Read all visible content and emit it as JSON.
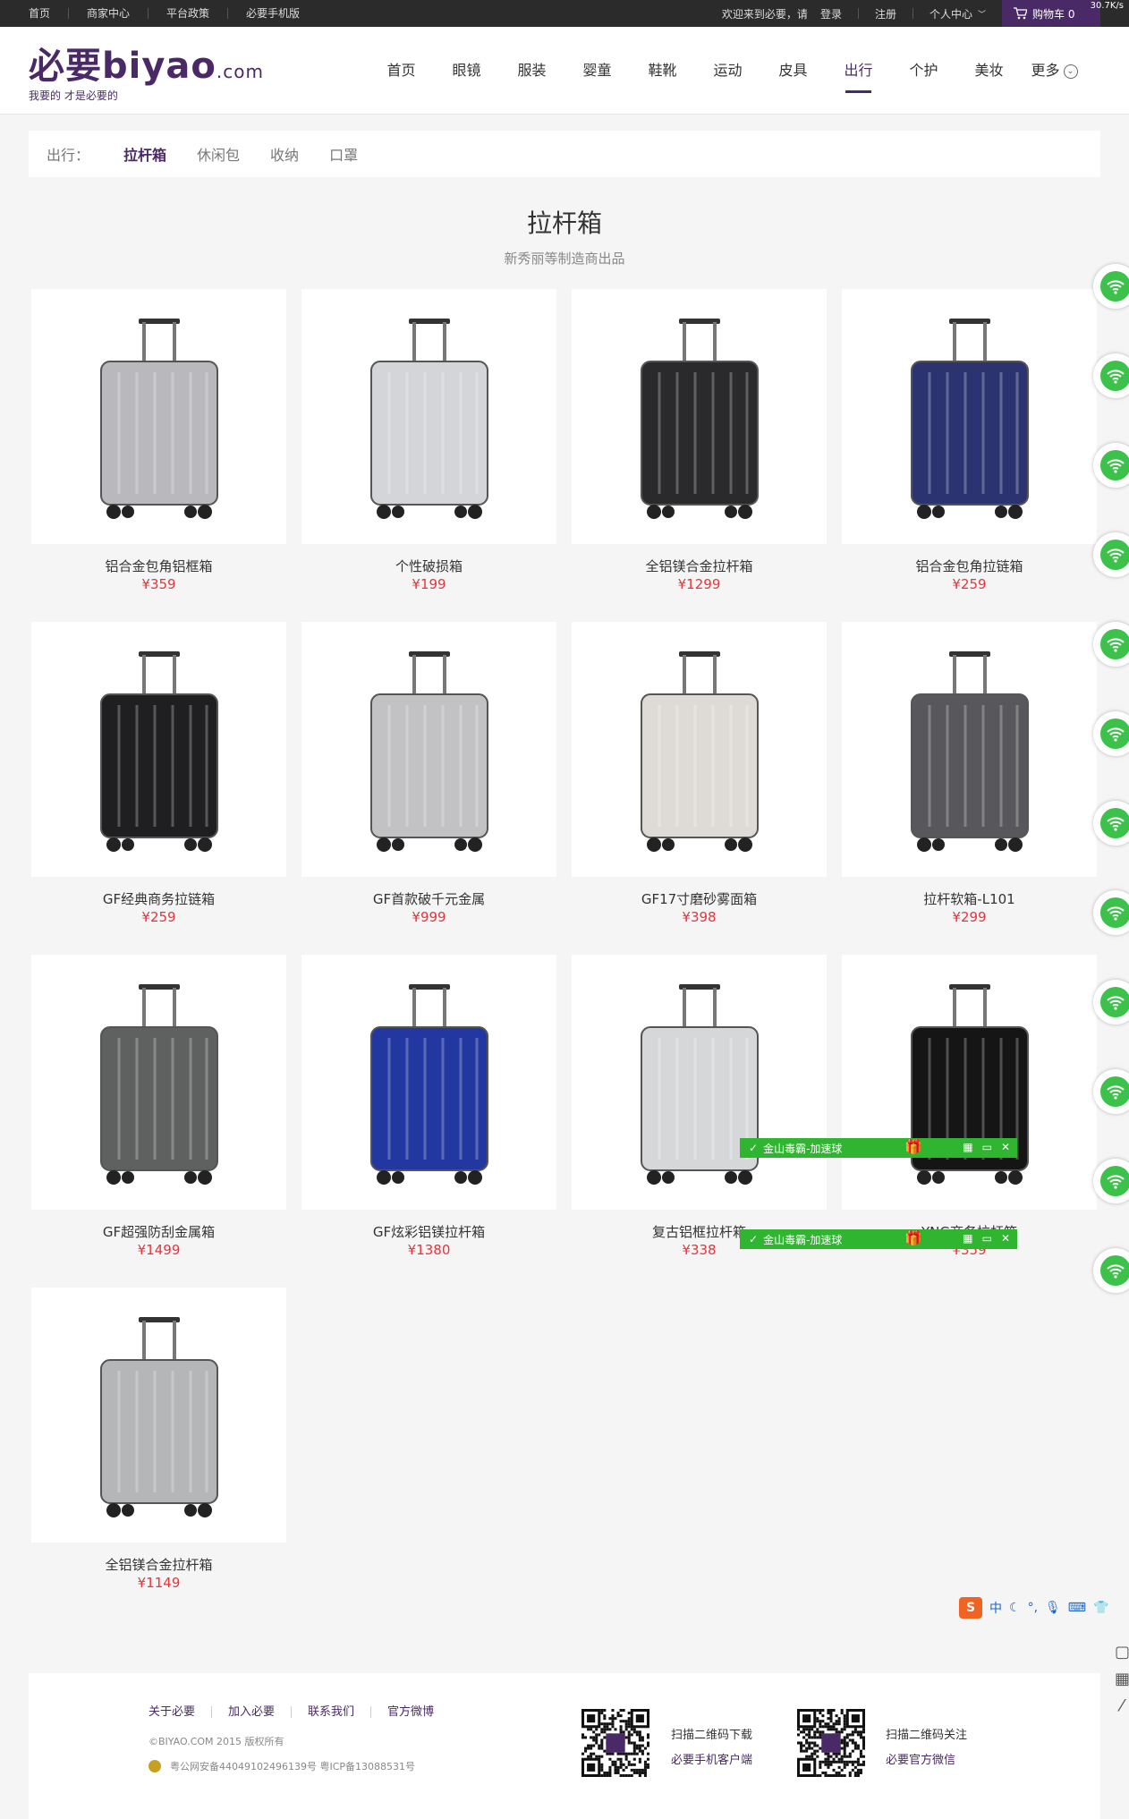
{
  "topbar": {
    "links": [
      "首页",
      "商家中心",
      "平台政策",
      "必要手机版"
    ],
    "welcome": "欢迎来到必要，请",
    "login": "登录",
    "register": "注册",
    "account": "个人中心",
    "cart": "购物车 0",
    "speed": "30.7K/s"
  },
  "logo": {
    "cn": "必要",
    "en": "biyao",
    "com": ".com",
    "slogan": "我要的 才是必要的"
  },
  "nav": {
    "items": [
      "首页",
      "眼镜",
      "服装",
      "婴童",
      "鞋靴",
      "运动",
      "皮具",
      "出行",
      "个护",
      "美妆",
      "更多"
    ],
    "active_index": 7
  },
  "category": {
    "label": "出行：",
    "tabs": [
      "拉杆箱",
      "休闲包",
      "收纳",
      "口罩"
    ],
    "active_index": 0
  },
  "page": {
    "title": "拉杆箱",
    "subtitle": "新秀丽等制造商出品"
  },
  "products": [
    {
      "name": "铝合金包角铝框箱",
      "price": "¥359",
      "color": "#b9b9bd"
    },
    {
      "name": "个性破损箱",
      "price": "¥199",
      "color": "#d4d5d8"
    },
    {
      "name": "全铝镁合金拉杆箱",
      "price": "¥1299",
      "color": "#2a2a2c"
    },
    {
      "name": "铝合金包角拉链箱",
      "price": "¥259",
      "color": "#2b3470"
    },
    {
      "name": "GF经典商务拉链箱",
      "price": "¥259",
      "color": "#1f1f21"
    },
    {
      "name": "GF首款破千元金属",
      "price": "¥999",
      "color": "#c2c2c4"
    },
    {
      "name": "GF17寸磨砂雾面箱",
      "price": "¥398",
      "color": "#dedbd6"
    },
    {
      "name": "拉杆软箱-L101",
      "price": "¥299",
      "color": "#58585c"
    },
    {
      "name": "GF超强防刮金属箱",
      "price": "¥1499",
      "color": "#5f6160"
    },
    {
      "name": "GF炫彩铝镁拉杆箱",
      "price": "¥1380",
      "color": "#2237a0"
    },
    {
      "name": "复古铝框拉杆箱",
      "price": "¥338",
      "color": "#d6d7d9"
    },
    {
      "name": "YNG商务拉杆箱",
      "price": "¥359",
      "color": "#151515"
    },
    {
      "name": "全铝镁合金拉杆箱",
      "price": "¥1149",
      "color": "#b4b6b8"
    }
  ],
  "overlay": {
    "toolbar_text": "金山毒霸-加速球"
  },
  "ime": {
    "logo": "S",
    "mode": "中"
  },
  "footer": {
    "links": [
      "关于必要",
      "加入必要",
      "联系我们",
      "官方微博"
    ],
    "copyright": "©BIYAO.COM 2015 版权所有",
    "icp": "粤公网安备44049102496139号 粤ICP备13088531号",
    "qr1_title": "扫描二维码下载",
    "qr1_sub": "必要手机客户端",
    "qr2_title": "扫描二维码关注",
    "qr2_sub": "必要官方微信"
  }
}
